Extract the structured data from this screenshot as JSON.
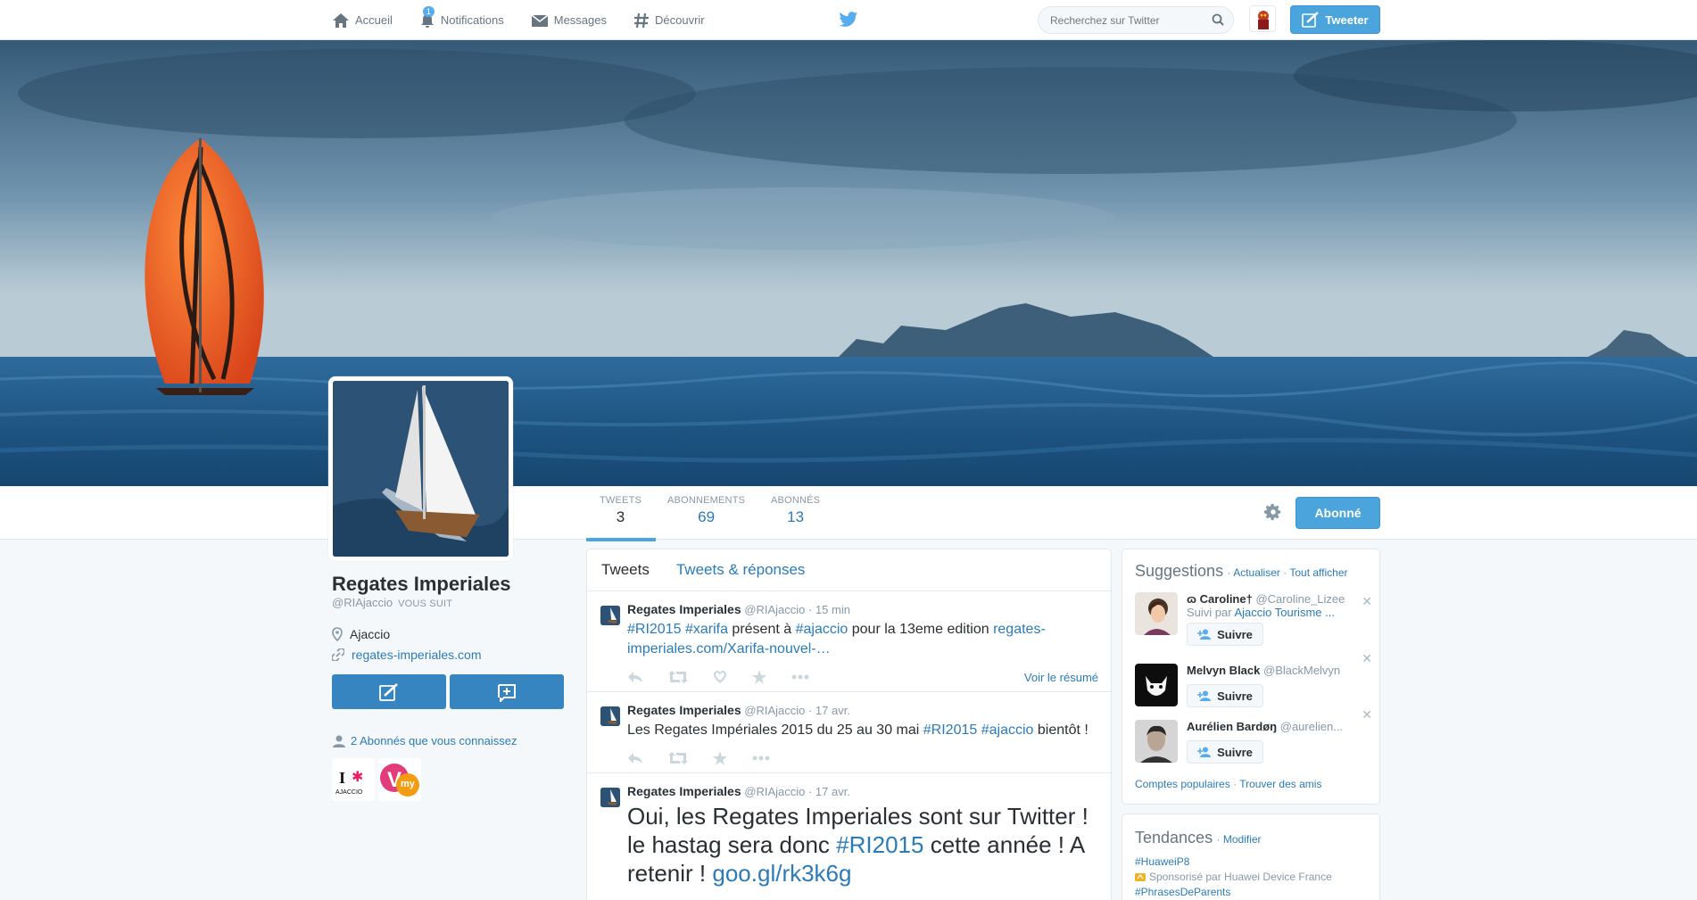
{
  "topbar": {
    "nav": [
      {
        "label": "Accueil",
        "icon": "home-icon"
      },
      {
        "label": "Notifications",
        "icon": "bell-icon",
        "badge": "1"
      },
      {
        "label": "Messages",
        "icon": "envelope-icon"
      },
      {
        "label": "Découvrir",
        "icon": "hashtag-icon"
      }
    ],
    "search_placeholder": "Recherchez sur Twitter",
    "tweet_button": "Tweeter",
    "brand_color": "#55acee"
  },
  "profile": {
    "name": "Regates Imperiales",
    "handle": "@RIAjaccio",
    "follows_you": "VOUS SUIT",
    "location": "Ajaccio",
    "website": "regates-imperiales.com",
    "known_followers": "2 Abonnés que vous connaissez",
    "stats": [
      {
        "label": "TWEETS",
        "value": "3"
      },
      {
        "label": "ABONNEMENTS",
        "value": "69"
      },
      {
        "label": "ABONNÉS",
        "value": "13"
      }
    ],
    "follow_button": "Abonné",
    "known_avatars": [
      {
        "text": "I",
        "text2": "AJACCIO"
      },
      {
        "text": "V",
        "text2": "my"
      }
    ]
  },
  "timeline": {
    "tabs": [
      "Tweets",
      "Tweets & réponses"
    ],
    "tweets": [
      {
        "name": "Regates Imperiales",
        "handle": "@RIAjaccio",
        "time": "15 min",
        "parts": [
          {
            "t": "#RI2015",
            "link": true
          },
          {
            "t": " ",
            "link": false
          },
          {
            "t": "#xarifa",
            "link": true
          },
          {
            "t": " présent à ",
            "link": false
          },
          {
            "t": "#ajaccio",
            "link": true
          },
          {
            "t": " pour la 13eme edition ",
            "link": false
          },
          {
            "t": "regates-imperiales.com/Xarifa-nouvel-…",
            "link": true
          }
        ],
        "summary": "Voir le résumé"
      },
      {
        "name": "Regates Imperiales",
        "handle": "@RIAjaccio",
        "time": "17 avr.",
        "parts": [
          {
            "t": "Les Regates Impériales 2015 du 25 au 30 mai ",
            "link": false
          },
          {
            "t": "#RI2015",
            "link": true
          },
          {
            "t": " ",
            "link": false
          },
          {
            "t": "#ajaccio",
            "link": true
          },
          {
            "t": " bientôt !",
            "link": false
          }
        ]
      },
      {
        "name": "Regates Imperiales",
        "handle": "@RIAjaccio",
        "time": "17 avr.",
        "parts": [
          {
            "t": "Oui, les Regates Imperiales sont sur Twitter ! le hastag sera donc ",
            "link": false
          },
          {
            "t": "#RI2015",
            "link": true
          },
          {
            "t": " cette année ! A retenir ! ",
            "link": false
          },
          {
            "t": "goo.gl/rk3k6g",
            "link": true
          }
        ]
      }
    ]
  },
  "suggestions": {
    "title": "Suggestions",
    "refresh": "Actualiser",
    "show_all": "Tout afficher",
    "follow_label": "Suivre",
    "items": [
      {
        "name": "ɷ Caroline†",
        "handle": "@Caroline_Lizee",
        "sub_prefix": "Suivi par ",
        "sub_link": "Ajaccio Tourisme ..."
      },
      {
        "name": "Melvyn Black",
        "handle": "@BlackMelvyn"
      },
      {
        "name": "Aurélien Bardøŋ",
        "handle": "@aurelien..."
      }
    ],
    "footer_left": "Comptes populaires",
    "footer_right": "Trouver des amis"
  },
  "trends": {
    "title": "Tendances",
    "modify": "Modifier",
    "items": [
      {
        "tag": "#HuaweiP8",
        "sponsor": "Sponsorisé par Huawei Device France"
      },
      {
        "tag": "#PhrasesDeParents"
      }
    ]
  }
}
